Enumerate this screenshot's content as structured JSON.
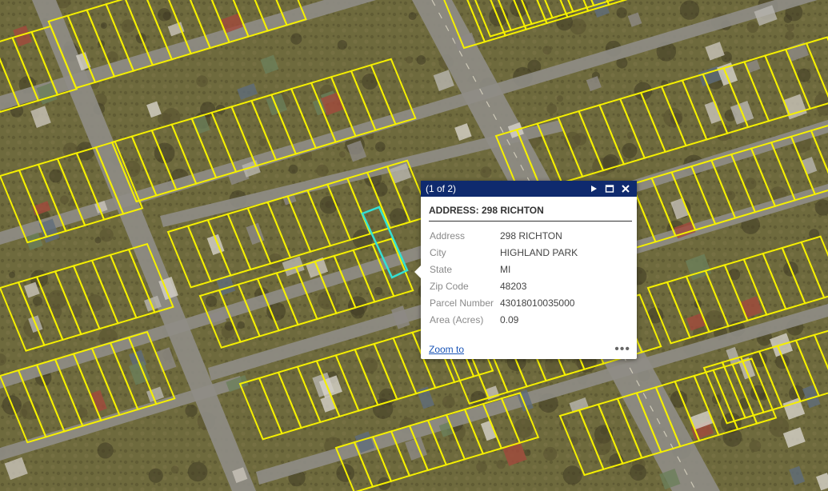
{
  "map": {
    "parcel_color": "#f5f000",
    "selected_color": "#34e0d4",
    "road_color": "#8f8d86"
  },
  "popup": {
    "count": "(1 of 2)",
    "icons": [
      "play-next-icon",
      "maximize-icon",
      "close-icon"
    ],
    "title": "ADDRESS: 298 RICHTON",
    "fields": [
      {
        "label": "Address",
        "value": "298 RICHTON"
      },
      {
        "label": "City",
        "value": "HIGHLAND PARK"
      },
      {
        "label": "State",
        "value": "MI"
      },
      {
        "label": "Zip Code",
        "value": "48203"
      },
      {
        "label": "Parcel Number",
        "value": "43018010035000"
      },
      {
        "label": "Area (Acres)",
        "value": "0.09"
      }
    ],
    "zoom_label": "Zoom to",
    "more_label": "•••",
    "header_color": "#0f2a6e"
  }
}
